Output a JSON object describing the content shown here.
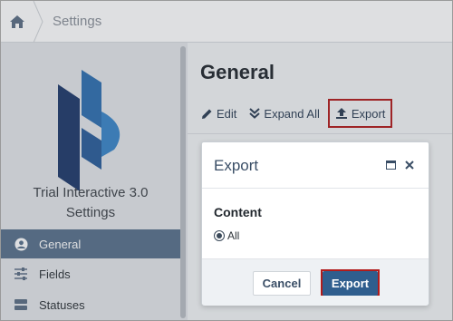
{
  "breadcrumb": {
    "current": "Settings"
  },
  "sidebar": {
    "title_line1": "Trial Interactive 3.0",
    "title_line2": "Settings",
    "items": [
      {
        "label": "General",
        "icon": "user-circle-icon",
        "active": true
      },
      {
        "label": "Fields",
        "icon": "sliders-icon",
        "active": false
      },
      {
        "label": "Statuses",
        "icon": "server-icon",
        "active": false
      }
    ]
  },
  "main": {
    "title": "General",
    "toolbar": {
      "edit": "Edit",
      "expand_all": "Expand All",
      "export": "Export"
    }
  },
  "dialog": {
    "title": "Export",
    "section_label": "Content",
    "radio_option": "All",
    "cancel": "Cancel",
    "export": "Export"
  },
  "colors": {
    "accent": "#2f5e8e",
    "nav_active": "#58718b",
    "highlight": "#b11c1c"
  }
}
